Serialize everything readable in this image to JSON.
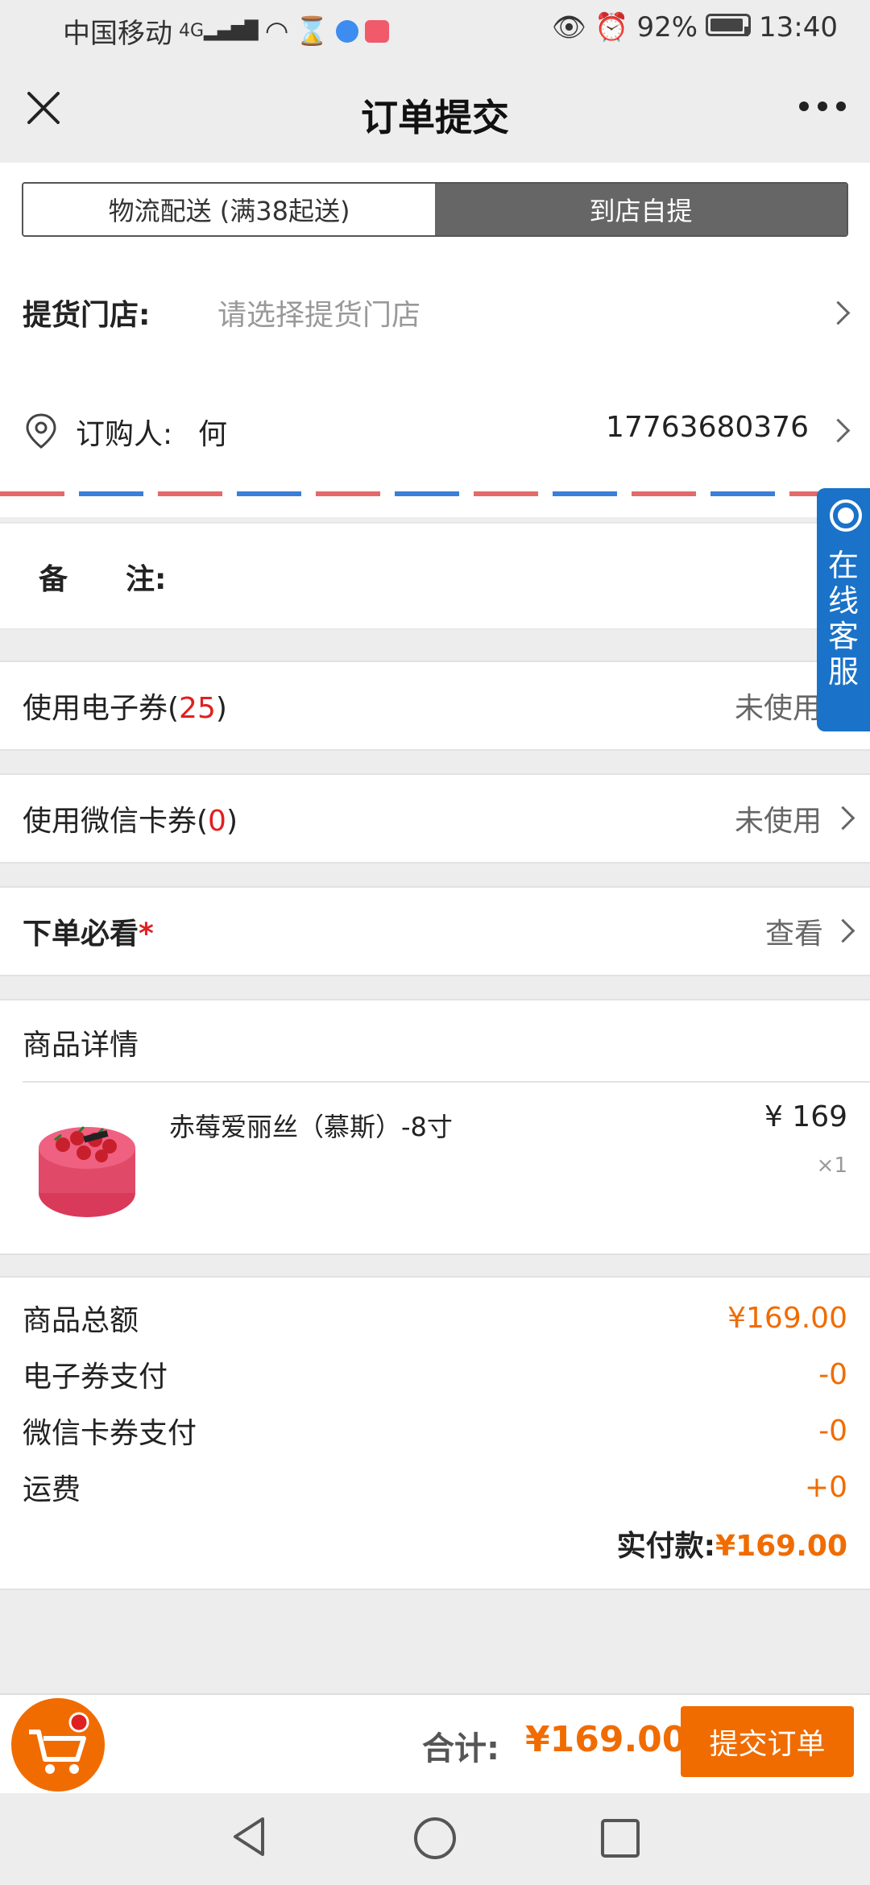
{
  "status": {
    "carrier": "中国移动",
    "signal": "⁴ᴳ",
    "battery": "92%",
    "time": "13:40"
  },
  "header": {
    "title": "订单提交"
  },
  "delivery": {
    "logistics_label": "物流配送 (满38起送)",
    "pickup_label": "到店自提"
  },
  "pickup_store": {
    "label": "提货门店:",
    "placeholder": "请选择提货门店"
  },
  "buyer": {
    "label": "订购人:",
    "name": "何",
    "phone": "17763680376"
  },
  "remark": {
    "label": "备　　注:"
  },
  "service": {
    "label": "在线客服"
  },
  "coupon": {
    "label": "使用电子券(",
    "count": "25",
    "close": ")",
    "value": "未使用"
  },
  "wechat_coupon": {
    "label": "使用微信卡券(",
    "count": "0",
    "close": ")",
    "value": "未使用"
  },
  "notice": {
    "label": "下单必看",
    "star": "*",
    "value": "查看"
  },
  "goods": {
    "section_title": "商品详情",
    "items": [
      {
        "name": "赤莓爱丽丝（慕斯）-8寸",
        "price": "¥ 169",
        "qty": "×1"
      }
    ]
  },
  "summary": {
    "rows": [
      {
        "label": "商品总额",
        "value": "¥169.00"
      },
      {
        "label": "电子券支付",
        "value": "-0"
      },
      {
        "label": "微信卡券支付",
        "value": "-0"
      },
      {
        "label": "运费",
        "value": "+0"
      }
    ],
    "actual_label": "实付款:",
    "actual_value": "¥169.00"
  },
  "footer": {
    "total_label": "合计:",
    "total_value": "¥169.00",
    "submit_label": "提交订单"
  },
  "colors": {
    "accent": "#f06c00",
    "red": "#e02020",
    "service_blue": "#1a72c9"
  }
}
